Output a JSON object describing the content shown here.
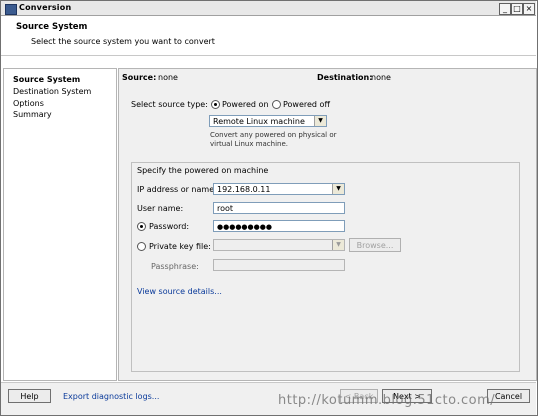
{
  "window": {
    "title": "Conversion",
    "controls": [
      "_",
      "□",
      "×"
    ]
  },
  "header": {
    "title": "Source System",
    "subtitle": "Select the source system you want to convert"
  },
  "nav": {
    "items": [
      {
        "label": "Source System",
        "active": true
      },
      {
        "label": "Destination System",
        "active": false
      },
      {
        "label": "Options",
        "active": false
      },
      {
        "label": "Summary",
        "active": false
      }
    ]
  },
  "main": {
    "source_label": "Source:",
    "source_value": "none",
    "destination_label": "Destination:",
    "destination_value": "none",
    "source_type_label": "Select source type:",
    "powered_on_label": "Powered on",
    "powered_off_label": "Powered off",
    "machine_type_value": "Remote Linux machine",
    "machine_type_desc": "Convert any powered on physical or virtual Linux machine.",
    "group_title": "Specify the powered on machine",
    "ip_label": "IP address or name:",
    "ip_value": "192.168.0.11",
    "user_label": "User name:",
    "user_value": "root",
    "password_label": "Password:",
    "password_value": "●●●●●●●●●",
    "private_key_label": "Private key file:",
    "browse_label": "Browse...",
    "passphrase_label": "Passphrase:",
    "view_details_link": "View source details..."
  },
  "footer": {
    "help_label": "Help",
    "export_link": "Export diagnostic logs...",
    "back_label": "< Back",
    "next_label": "Next >",
    "cancel_label": "Cancel"
  },
  "watermark": "http://kotumm.blog.51cto.com/",
  "colors": {
    "link": "#0a3a9a",
    "field_border": "#7f9db9"
  }
}
